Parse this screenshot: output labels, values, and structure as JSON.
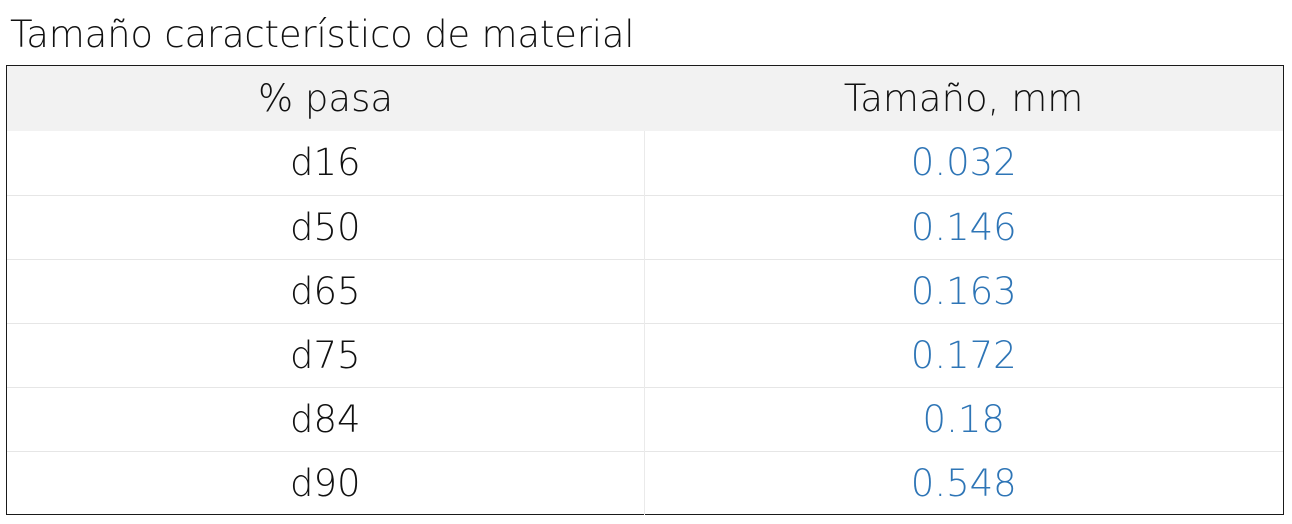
{
  "title": "Tamaño característico de material",
  "table": {
    "headers": [
      "% pasa",
      "Tamaño, mm"
    ],
    "rows": [
      {
        "label": "d16",
        "value": "0.032"
      },
      {
        "label": "d50",
        "value": "0.146"
      },
      {
        "label": "d65",
        "value": "0.163"
      },
      {
        "label": "d75",
        "value": "0.172"
      },
      {
        "label": "d84",
        "value": "0.18"
      },
      {
        "label": "d90",
        "value": "0.548"
      }
    ]
  },
  "colors": {
    "header_background": "#f2f2f2",
    "value_text": "#2e75b6",
    "border": "#1a1a1a"
  }
}
